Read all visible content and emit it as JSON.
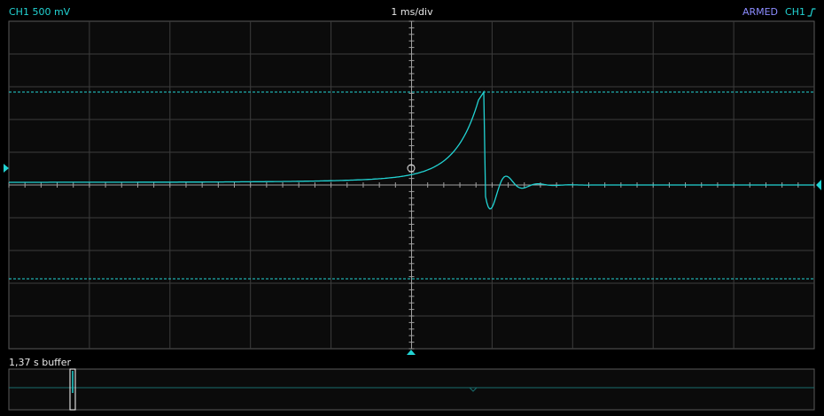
{
  "header": {
    "channel_label": "CH1 500 mV",
    "timebase": "1 ms/div",
    "status": "ARMED",
    "trigger_source": "CH1"
  },
  "icons": {
    "trigger_edge": "rising-edge-icon",
    "trigger_level_marker": "triangle-right-marker",
    "channel_offset_marker": "triangle-left-marker",
    "trigger_position_marker": "triangle-up-marker"
  },
  "buffer": {
    "label": "1,37 s buffer"
  },
  "colors": {
    "trace": "#22d3d3",
    "grid": "#3c3c3c",
    "axis": "#a0a0a0",
    "status": "#8c8cff",
    "background": "#0b0b0b"
  }
}
